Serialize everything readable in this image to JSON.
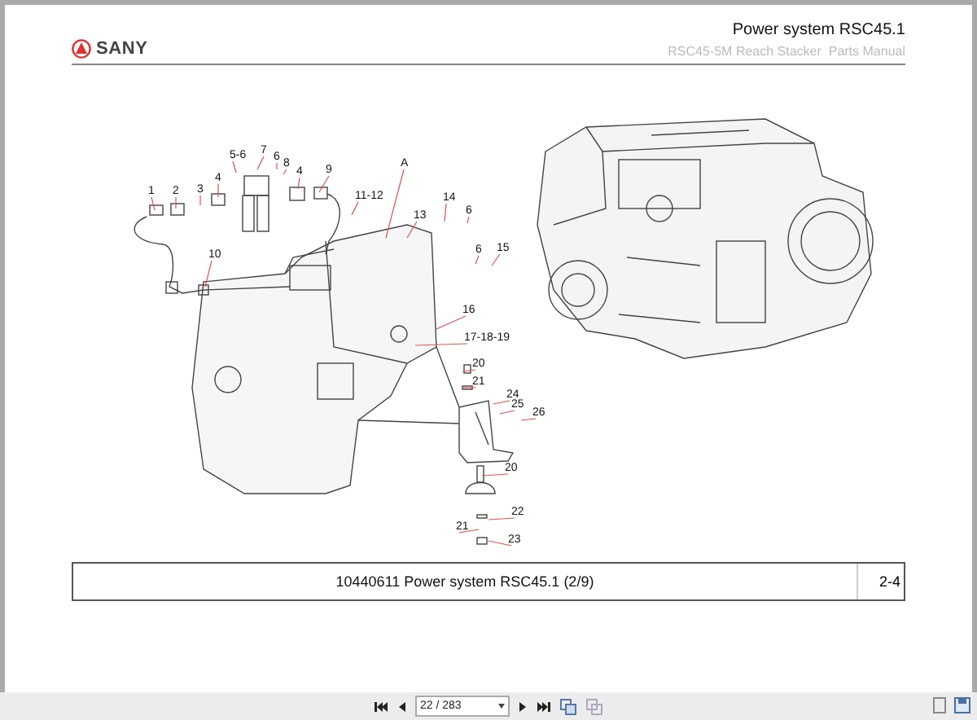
{
  "header": {
    "logo": "SANY",
    "title": "Power system RSC45.1",
    "subtitle": "RSC45-5M Reach Stacker  Parts Manual"
  },
  "callouts": [
    {
      "label": "1"
    },
    {
      "label": "2"
    },
    {
      "label": "3"
    },
    {
      "label": "4"
    },
    {
      "label": "5-6"
    },
    {
      "label": "7"
    },
    {
      "label": "6"
    },
    {
      "label": "8"
    },
    {
      "label": "4"
    },
    {
      "label": "9"
    },
    {
      "label": "A"
    },
    {
      "label": "11-12"
    },
    {
      "label": "13"
    },
    {
      "label": "14"
    },
    {
      "label": "6"
    },
    {
      "label": "6"
    },
    {
      "label": "15"
    },
    {
      "label": "10"
    },
    {
      "label": "16"
    },
    {
      "label": "17-18-19"
    },
    {
      "label": "20"
    },
    {
      "label": "21"
    },
    {
      "label": "24"
    },
    {
      "label": "25"
    },
    {
      "label": "26"
    },
    {
      "label": "20"
    },
    {
      "label": "22"
    },
    {
      "label": "21"
    },
    {
      "label": "23"
    }
  ],
  "caption": {
    "text": "10440611 Power system RSC45.1 (2/9)",
    "page": "2-4"
  },
  "toolbar": {
    "page_field": "22 / 283"
  }
}
